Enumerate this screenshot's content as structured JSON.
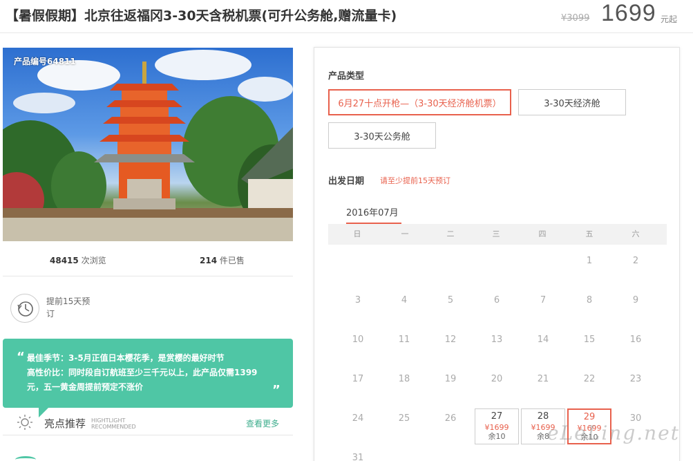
{
  "header": {
    "title": "【暑假假期】北京往返福冈3-30天含税机票(可升公务舱,赠流量卡)",
    "price_original": "¥3099",
    "price_current": "1699",
    "price_unit": "元起"
  },
  "hero": {
    "product_code": "产品编号64811"
  },
  "stats": {
    "views_count": "48415",
    "views_label": "次浏览",
    "sold_count": "214",
    "sold_label": "件已售"
  },
  "advance": {
    "text": "提前15天预订",
    "icon": "clock-icon"
  },
  "quote": {
    "open_mark": "“",
    "close_mark": "”",
    "line1": "最佳季节：3-5月正值日本樱花季，是赏樱的最好时节",
    "line2": "高性价比：同时段自订航班至少三千元以上，此产品仅需1399元，五一黄金周提前预定不涨价"
  },
  "highlights": {
    "title": "亮点推荐",
    "en_line1": "HIGHTLIGHT",
    "en_line2": "RECOMMENDED",
    "more": "查看更多",
    "icon": "sun-icon"
  },
  "booking": {
    "type_label": "产品类型",
    "types": [
      {
        "label": "6月27十点开枪—（3-30天经济舱机票）"
      },
      {
        "label": "3-30天经济舱"
      },
      {
        "label": "3-30天公务舱"
      }
    ],
    "date_label": "出发日期",
    "date_note": "请至少提前15天预订",
    "month": "2016年07月",
    "weekdays": [
      "日",
      "一",
      "二",
      "三",
      "四",
      "五",
      "六"
    ],
    "days": [
      {
        "d": "1"
      },
      {
        "d": "2"
      },
      {
        "d": "3"
      },
      {
        "d": "4"
      },
      {
        "d": "5"
      },
      {
        "d": "6"
      },
      {
        "d": "7"
      },
      {
        "d": "8"
      },
      {
        "d": "9"
      },
      {
        "d": "10"
      },
      {
        "d": "11"
      },
      {
        "d": "12"
      },
      {
        "d": "13"
      },
      {
        "d": "14"
      },
      {
        "d": "15"
      },
      {
        "d": "16"
      },
      {
        "d": "17"
      },
      {
        "d": "18"
      },
      {
        "d": "19"
      },
      {
        "d": "20"
      },
      {
        "d": "21"
      },
      {
        "d": "22"
      },
      {
        "d": "23"
      },
      {
        "d": "24"
      },
      {
        "d": "25"
      },
      {
        "d": "26"
      },
      {
        "d": "27",
        "price": "¥1699",
        "left": "余10"
      },
      {
        "d": "28",
        "price": "¥1699",
        "left": "余8"
      },
      {
        "d": "29",
        "price": "¥1699",
        "left": "余10"
      },
      {
        "d": "30"
      },
      {
        "d": "31"
      }
    ]
  },
  "watermark": "eLeLing.net",
  "colors": {
    "accent": "#e8604c",
    "green": "#4fc6a5"
  }
}
